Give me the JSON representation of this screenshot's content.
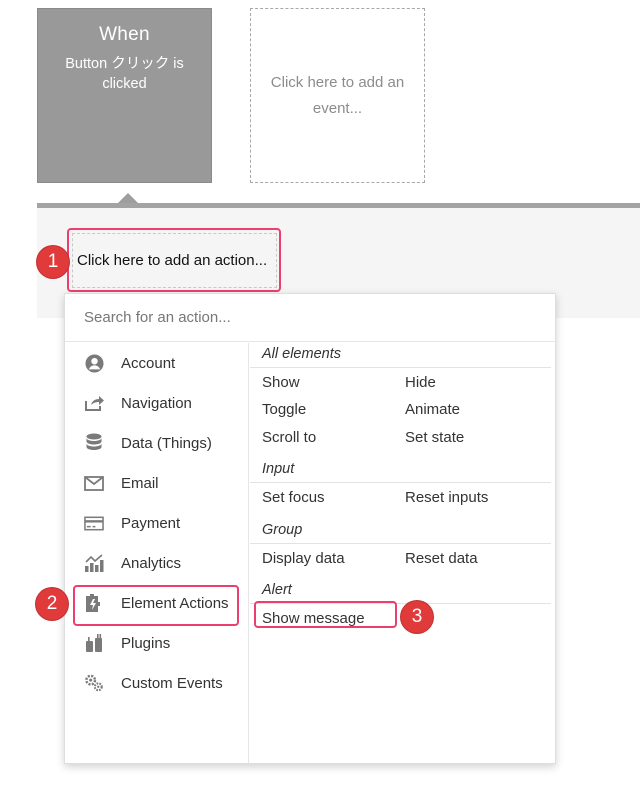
{
  "event_card": {
    "title": "When",
    "description": "Button クリック is clicked"
  },
  "add_event": {
    "label": "Click here to add an event..."
  },
  "add_action": {
    "label": "Click here to add an action..."
  },
  "steps": [
    "1",
    "2",
    "3"
  ],
  "dropdown": {
    "search_placeholder": "Search for an action...",
    "categories": [
      {
        "label": "Account",
        "icon": "account-icon"
      },
      {
        "label": "Navigation",
        "icon": "navigation-icon"
      },
      {
        "label": "Data (Things)",
        "icon": "database-icon"
      },
      {
        "label": "Email",
        "icon": "email-icon"
      },
      {
        "label": "Payment",
        "icon": "payment-icon"
      },
      {
        "label": "Analytics",
        "icon": "analytics-icon"
      },
      {
        "label": "Element Actions",
        "icon": "element-actions-icon"
      },
      {
        "label": "Plugins",
        "icon": "plugins-icon"
      },
      {
        "label": "Custom Events",
        "icon": "custom-events-icon"
      }
    ],
    "groups": {
      "all_elements": {
        "title": "All elements",
        "actions": [
          "Show",
          "Hide",
          "Toggle",
          "Animate",
          "Scroll to",
          "Set state"
        ]
      },
      "input": {
        "title": "Input",
        "actions": [
          "Set focus",
          "Reset inputs"
        ]
      },
      "group": {
        "title": "Group",
        "actions": [
          "Display data",
          "Reset data"
        ]
      },
      "alert": {
        "title": "Alert",
        "actions": [
          "Show message"
        ]
      }
    }
  },
  "colors": {
    "highlight": "#ec3f6f",
    "step_marker": "#e03a3a",
    "event_card": "#999999"
  }
}
